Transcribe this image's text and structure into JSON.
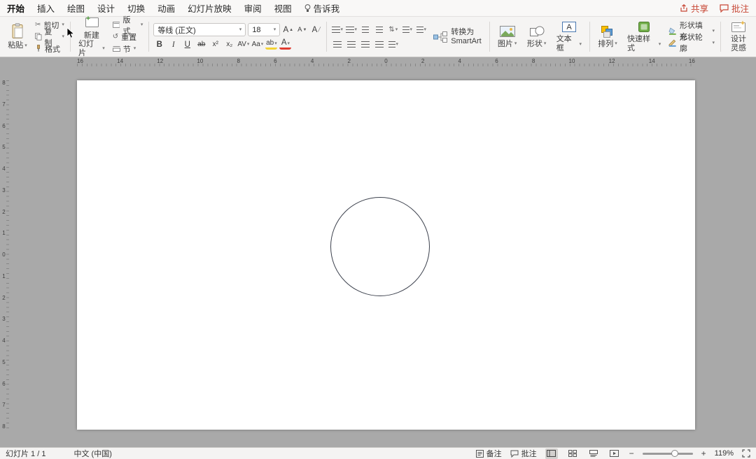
{
  "menu": {
    "items": [
      "开始",
      "插入",
      "绘图",
      "设计",
      "切换",
      "动画",
      "幻灯片放映",
      "审阅",
      "视图",
      "告诉我"
    ],
    "share": "共享",
    "comments": "批注"
  },
  "icons": {
    "chevron_down": "▾",
    "scissors": "✂",
    "reset": "↺",
    "line_spacing": "⇅",
    "minus": "−",
    "plus": "+"
  },
  "ribbon": {
    "clipboard": {
      "paste": "粘贴",
      "cut": "剪切",
      "copy": "复制",
      "format_painter": "格式"
    },
    "slides": {
      "new_slide_line1": "新建",
      "new_slide_line2": "幻灯片",
      "layout": "版式",
      "reset": "重置",
      "section": "节"
    },
    "font": {
      "family": "等线 (正文)",
      "size": "18",
      "grow": "A",
      "shrink": "A",
      "clear": "A",
      "bold": "B",
      "italic": "I",
      "underline": "U",
      "strike": "ab",
      "superscript": "x²",
      "subscript": "x₂",
      "spacing": "AV",
      "case": "Aa",
      "highlight": "ab",
      "color": "A"
    },
    "paragraph": {
      "convert_line1": "转换为",
      "convert_line2": "SmartArt"
    },
    "insert": {
      "picture": "图片",
      "shapes": "形状",
      "textbox": "文本框"
    },
    "arrange": {
      "arrange": "排列",
      "quick_styles": "快速样式",
      "shape_fill": "形状填充",
      "shape_outline": "形状轮廓"
    },
    "design": {
      "line1": "设计",
      "line2": "灵感"
    }
  },
  "ruler": {
    "h_numbers": [
      "16",
      "14",
      "12",
      "10",
      "8",
      "6",
      "4",
      "2",
      "0",
      "2",
      "4",
      "6",
      "8",
      "10",
      "12",
      "14",
      "16"
    ],
    "v_numbers": [
      "8",
      "7",
      "6",
      "5",
      "4",
      "3",
      "2",
      "1",
      "0",
      "1",
      "2",
      "3",
      "4",
      "5",
      "6",
      "7",
      "8"
    ]
  },
  "slide": {
    "shapes": [
      {
        "type": "ellipse",
        "stroke": "#3c414d",
        "fill": "none"
      }
    ]
  },
  "statusbar": {
    "slide_counter": "幻灯片 1 / 1",
    "language": "中文 (中国)",
    "notes": "备注",
    "comments": "批注",
    "zoom": "119%"
  },
  "colors": {
    "accent": "#c74634",
    "canvas_bg": "#a9a9a9",
    "slide_bg": "#ffffff"
  }
}
